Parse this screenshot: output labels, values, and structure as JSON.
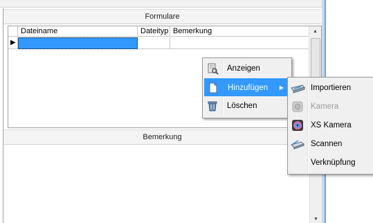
{
  "sections": {
    "forms_title": "Formulare",
    "notes_title": "Bemerkung"
  },
  "grid": {
    "columns": [
      "Dateiname",
      "Dateityp",
      "Bemerkung"
    ],
    "current_row_marker": "▶"
  },
  "context_menu": {
    "items": [
      {
        "label": "Anzeigen",
        "icon": "view-document-icon"
      },
      {
        "label": "Hinzufügen",
        "icon": "add-document-icon",
        "highlighted": true,
        "submenu_arrow": "▶"
      },
      {
        "label": "Löschen",
        "icon": "trash-icon"
      }
    ]
  },
  "submenu": {
    "items": [
      {
        "label": "Importieren",
        "icon": "import-scanner-icon"
      },
      {
        "label": "Kamera",
        "icon": "camera-icon",
        "disabled": true
      },
      {
        "label": "XS Kamera",
        "icon": "xs-camera-icon"
      },
      {
        "label": "Scannen",
        "icon": "scanner-icon"
      },
      {
        "label": "Verknüpfung",
        "icon": ""
      }
    ]
  },
  "colors": {
    "highlight": "#3399ff",
    "menu_bg": "#f0f0f0",
    "accent_border": "#7aa0cf"
  }
}
